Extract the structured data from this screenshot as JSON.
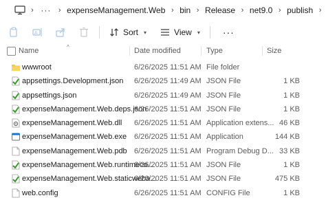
{
  "breadcrumb": {
    "more": "···",
    "items": [
      "expenseManagement.Web",
      "bin",
      "Release",
      "net9.0",
      "publish"
    ]
  },
  "toolbar": {
    "sort_label": "Sort",
    "view_label": "View",
    "more": "···"
  },
  "columns": {
    "name": "Name",
    "date": "Date modified",
    "type": "Type",
    "size": "Size"
  },
  "files": [
    {
      "name": "wwwroot",
      "date": "6/26/2025 11:51 AM",
      "type": "File folder",
      "size": "",
      "icon": "folder-icon"
    },
    {
      "name": "appsettings.Development.json",
      "date": "6/26/2025 11:49 AM",
      "type": "JSON File",
      "size": "1 KB",
      "icon": "json-file-icon"
    },
    {
      "name": "appsettings.json",
      "date": "6/26/2025 11:49 AM",
      "type": "JSON File",
      "size": "1 KB",
      "icon": "json-file-icon"
    },
    {
      "name": "expenseManagement.Web.deps.json",
      "date": "6/26/2025 11:51 AM",
      "type": "JSON File",
      "size": "1 KB",
      "icon": "json-file-icon"
    },
    {
      "name": "expenseManagement.Web.dll",
      "date": "6/26/2025 11:51 AM",
      "type": "Application extens...",
      "size": "46 KB",
      "icon": "dll-file-icon"
    },
    {
      "name": "expenseManagement.Web.exe",
      "date": "6/26/2025 11:51 AM",
      "type": "Application",
      "size": "144 KB",
      "icon": "exe-file-icon"
    },
    {
      "name": "expenseManagement.Web.pdb",
      "date": "6/26/2025 11:51 AM",
      "type": "Program Debug D...",
      "size": "33 KB",
      "icon": "pdb-file-icon"
    },
    {
      "name": "expenseManagement.Web.runtimeco...",
      "date": "6/26/2025 11:51 AM",
      "type": "JSON File",
      "size": "1 KB",
      "icon": "json-file-icon"
    },
    {
      "name": "expenseManagement.Web.staticweba...",
      "date": "6/26/2025 11:51 AM",
      "type": "JSON File",
      "size": "475 KB",
      "icon": "json-file-icon"
    },
    {
      "name": "web.config",
      "date": "6/26/2025 11:51 AM",
      "type": "CONFIG File",
      "size": "1 KB",
      "icon": "config-file-icon"
    }
  ]
}
